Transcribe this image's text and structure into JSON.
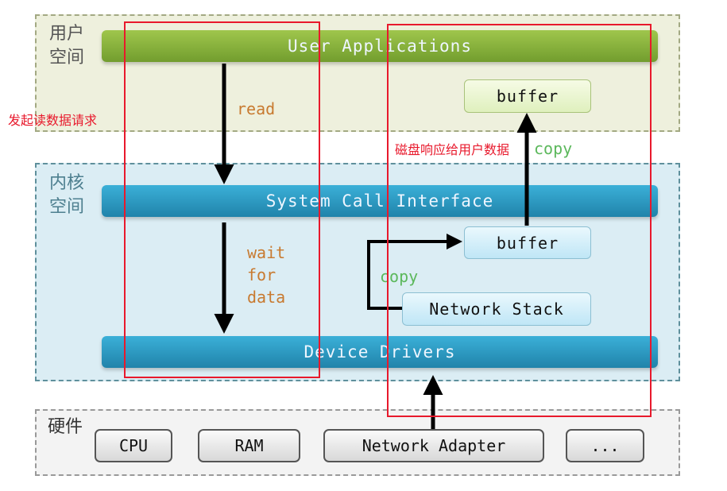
{
  "zones": {
    "user": "用户\n空间",
    "user_l1": "用户",
    "user_l2": "空间",
    "kernel_l1": "内核",
    "kernel_l2": "空间",
    "hardware": "硬件"
  },
  "layers": {
    "user_apps": "User Applications",
    "syscall": "System Call Interface",
    "drivers": "Device Drivers"
  },
  "boxes": {
    "user_buffer": "buffer",
    "kernel_buffer": "buffer",
    "network_stack": "Network Stack"
  },
  "hardware": [
    "CPU",
    "RAM",
    "Network Adapter",
    "..."
  ],
  "labels": {
    "read": "read",
    "wait": "wait",
    "for": "for",
    "data": "data",
    "copy_up": "copy",
    "copy_kernel": "copy"
  },
  "annotations": {
    "left": "发起读数据请求",
    "right": "磁盘响应给用户数据"
  },
  "colors": {
    "annotation": "#e8192c",
    "read_label": "#c87a30",
    "copy_label": "#5cb85c",
    "user_bar": "#86b03c",
    "kernel_bar": "#2a93bd"
  }
}
